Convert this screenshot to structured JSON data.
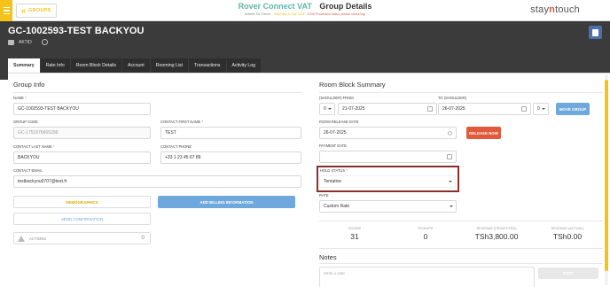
{
  "topbar": {
    "groups_label": "GROUPS",
    "hotel_name": "Rover Connect VAT",
    "page_title": "Group Details",
    "user": "Antoine De Conze",
    "business_date": "Saturday, 8 July 2025",
    "alert": "EOD Processes failed, please check log!",
    "logo_a": "stay",
    "logo_b": "n",
    "logo_c": "touch"
  },
  "header": {
    "group_title": "GC-1002593-TEST BACKYOU",
    "status_label": "AKTID"
  },
  "tabs": [
    {
      "label": "Summary"
    },
    {
      "label": "Rate Info"
    },
    {
      "label": "Room Block Details"
    },
    {
      "label": "Account"
    },
    {
      "label": "Rooming List"
    },
    {
      "label": "Transactions"
    },
    {
      "label": "Activity Log"
    }
  ],
  "group_info": {
    "title": "Group Info",
    "name_label": "NAME",
    "name_value": "GC-1002593-TEST BACKYOU",
    "group_code_label": "GROUP CODE",
    "group_code_value": "GC-1751976665208",
    "contact_first_label": "CONTACT FIRST NAME",
    "contact_first_value": "TEST",
    "contact_last_label": "CONTACT LAST NAME",
    "contact_last_value": "BACKYOU",
    "contact_phone_label": "CONTACT PHONE",
    "contact_phone_value": "+33 1 23 45 67 89",
    "contact_email_label": "CONTACT EMAIL",
    "contact_email_value": "testbackyou0707@test.fr",
    "demographics_label": "DEMOGRAPHICS",
    "billing_label": "ADD BILLING INFORMATION",
    "send_confirmation_label": "SEND CONFIRMATION",
    "actions_label": "ACTIONS",
    "actions_count": "0"
  },
  "room_block": {
    "title": "Room Block Summary",
    "from_label": "(SHOULDER) FROM",
    "from_shoulder": "0",
    "from_date": "21-07-2025",
    "to_label": "(SHOULDER)",
    "to_prefix": "TO",
    "to_date": "26-07-2025",
    "to_shoulder": "0",
    "move_group_label": "MOVE GROUP",
    "release_date_label": "ROOM RELEASE DATE",
    "release_date_value": "26-07-2025",
    "release_now_label": "RELEASE NOW",
    "payment_date_label": "PAYMENT DATE",
    "payment_date_value": "",
    "hold_status_label": "HOLD STATUS",
    "hold_status_value": "Tentative",
    "rate_label": "RATE",
    "rate_value": "Custom Rate"
  },
  "stats": [
    {
      "label": "ROOMS",
      "value": "31"
    },
    {
      "label": "PICKUPS",
      "value": "0"
    },
    {
      "label": "REVENUE (PROJECTED)",
      "value": "TSh3,800.00"
    },
    {
      "label": "REVENUE (ACTUAL)",
      "value": "TSh0.00"
    }
  ],
  "notes": {
    "title": "Notes",
    "placeholder": "Write a note.",
    "post_label": "POST"
  },
  "colors": {
    "accent_yellow": "#f3c31a",
    "brand_teal": "#5fb6a6",
    "header_dark": "#3b3b3b",
    "blue_button": "#6fa8dc",
    "red_button": "#e05a3b",
    "hold_outline": "#8b2f2a"
  }
}
